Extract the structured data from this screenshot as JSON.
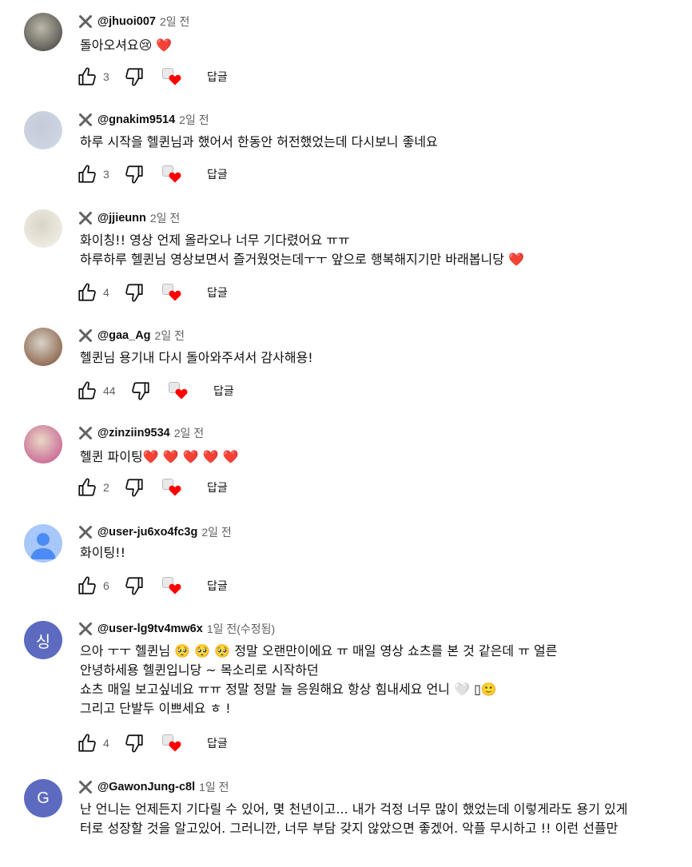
{
  "comments": [
    {
      "handle": "@jhuoi007",
      "time": "2일 전",
      "lines": [
        "돌아오셔요😢 ❤️"
      ],
      "likes": "3",
      "reply": "답글",
      "avatar": {
        "kind": "photo",
        "colors": [
          "#3a3a3a",
          "#bdb8a8"
        ]
      }
    },
    {
      "handle": "@gnakim9514",
      "time": "2일 전",
      "lines": [
        "하루 시작을 헬퀸님과 했어서 한동안 허전했었는데 다시보니 좋네요"
      ],
      "likes": "3",
      "reply": "답글",
      "avatar": {
        "kind": "photo",
        "colors": [
          "#d3dae6",
          "#c3cad8"
        ]
      }
    },
    {
      "handle": "@jjieunn",
      "time": "2일 전",
      "lines": [
        "화이칭!! 영상 언제 올라오나 너무 기다렸어요 ㅠㅠ",
        "하루하루 헬퀸님 영상보면서 즐거웠엇는데ㅜㅜ 앞으로 행복해지기만 바래봅니당 ❤️"
      ],
      "likes": "4",
      "reply": "답글",
      "avatar": {
        "kind": "photo",
        "colors": [
          "#f6f4ee",
          "#d9d4c6"
        ]
      }
    },
    {
      "handle": "@gaa_Ag",
      "time": "2일 전",
      "lines": [
        "헬퀸님 용기내 다시 돌아와주셔서 감사해용!"
      ],
      "likes": "44",
      "reply": "답글",
      "avatar": {
        "kind": "photo",
        "colors": [
          "#7a4a2c",
          "#d8d2c8"
        ]
      }
    },
    {
      "handle": "@zinziin9534",
      "time": "2일 전",
      "lines": [
        "헬퀸 파이팅❤️ ❤️ ❤️ ❤️ ❤️"
      ],
      "likes": "2",
      "reply": "답글",
      "avatar": {
        "kind": "photo",
        "colors": [
          "#c24a8a",
          "#e8d9c4"
        ]
      }
    },
    {
      "handle": "@user-ju6xo4fc3g",
      "time": "2일 전",
      "lines": [
        "화이팅!!"
      ],
      "likes": "6",
      "reply": "답글",
      "avatar": {
        "kind": "default",
        "colors": [
          "#a8c7fa",
          "#4c8bf5"
        ]
      }
    },
    {
      "handle": "@user-lg9tv4mw6x",
      "time": "1일 전(수정됨)",
      "lines": [
        "으아 ㅜㅜ 헬퀸님 🥺 🥺 🥺 정말 오랜만이에요 ㅠ 매일 영상 쇼츠를 본 것 같은데 ㅠ 얼른",
        "안녕하세용 헬퀸입니당 ~ 목소리로 시작하던",
        "쇼츠 매일 보고싶네요 ㅠㅠ  정말 정말 늘 응원해요 항상 힘내세요 언니 🤍 ▯🙂",
        "그리고 단발두 이쁘세요 ㅎ !"
      ],
      "likes": "4",
      "reply": "답글",
      "avatar": {
        "kind": "letter",
        "letter": "싱",
        "colors": [
          "#5c6bc0",
          "#5c6bc0"
        ]
      }
    },
    {
      "handle": "@GawonJung-c8l",
      "time": "1일 전",
      "lines": [
        "난 언니는 언제든지 기다릴 수 있어, 몇 천년이고... 내가 걱정 너무 많이 했었는데 이렇게라도 용기 있게",
        "터로 성장할 것을 알고있어. 그러니깐, 너무 부담 갖지 않았으면 좋겠어. 악플 무시하고 !! 이런 선플만"
      ],
      "likes": "",
      "reply": "",
      "avatar": {
        "kind": "letter",
        "letter": "G",
        "colors": [
          "#5c6bc0",
          "#5c6bc0"
        ]
      }
    }
  ],
  "icons": {
    "remove": "x-icon",
    "like": "thumbs-up-icon",
    "dislike": "thumbs-down-icon",
    "creator_heart": "creator-heart-icon"
  },
  "colors": {
    "text": "#0f0f0f",
    "secondary": "#606060",
    "heart": "#ff0000",
    "letter_avatar": "#5c6bc0"
  }
}
